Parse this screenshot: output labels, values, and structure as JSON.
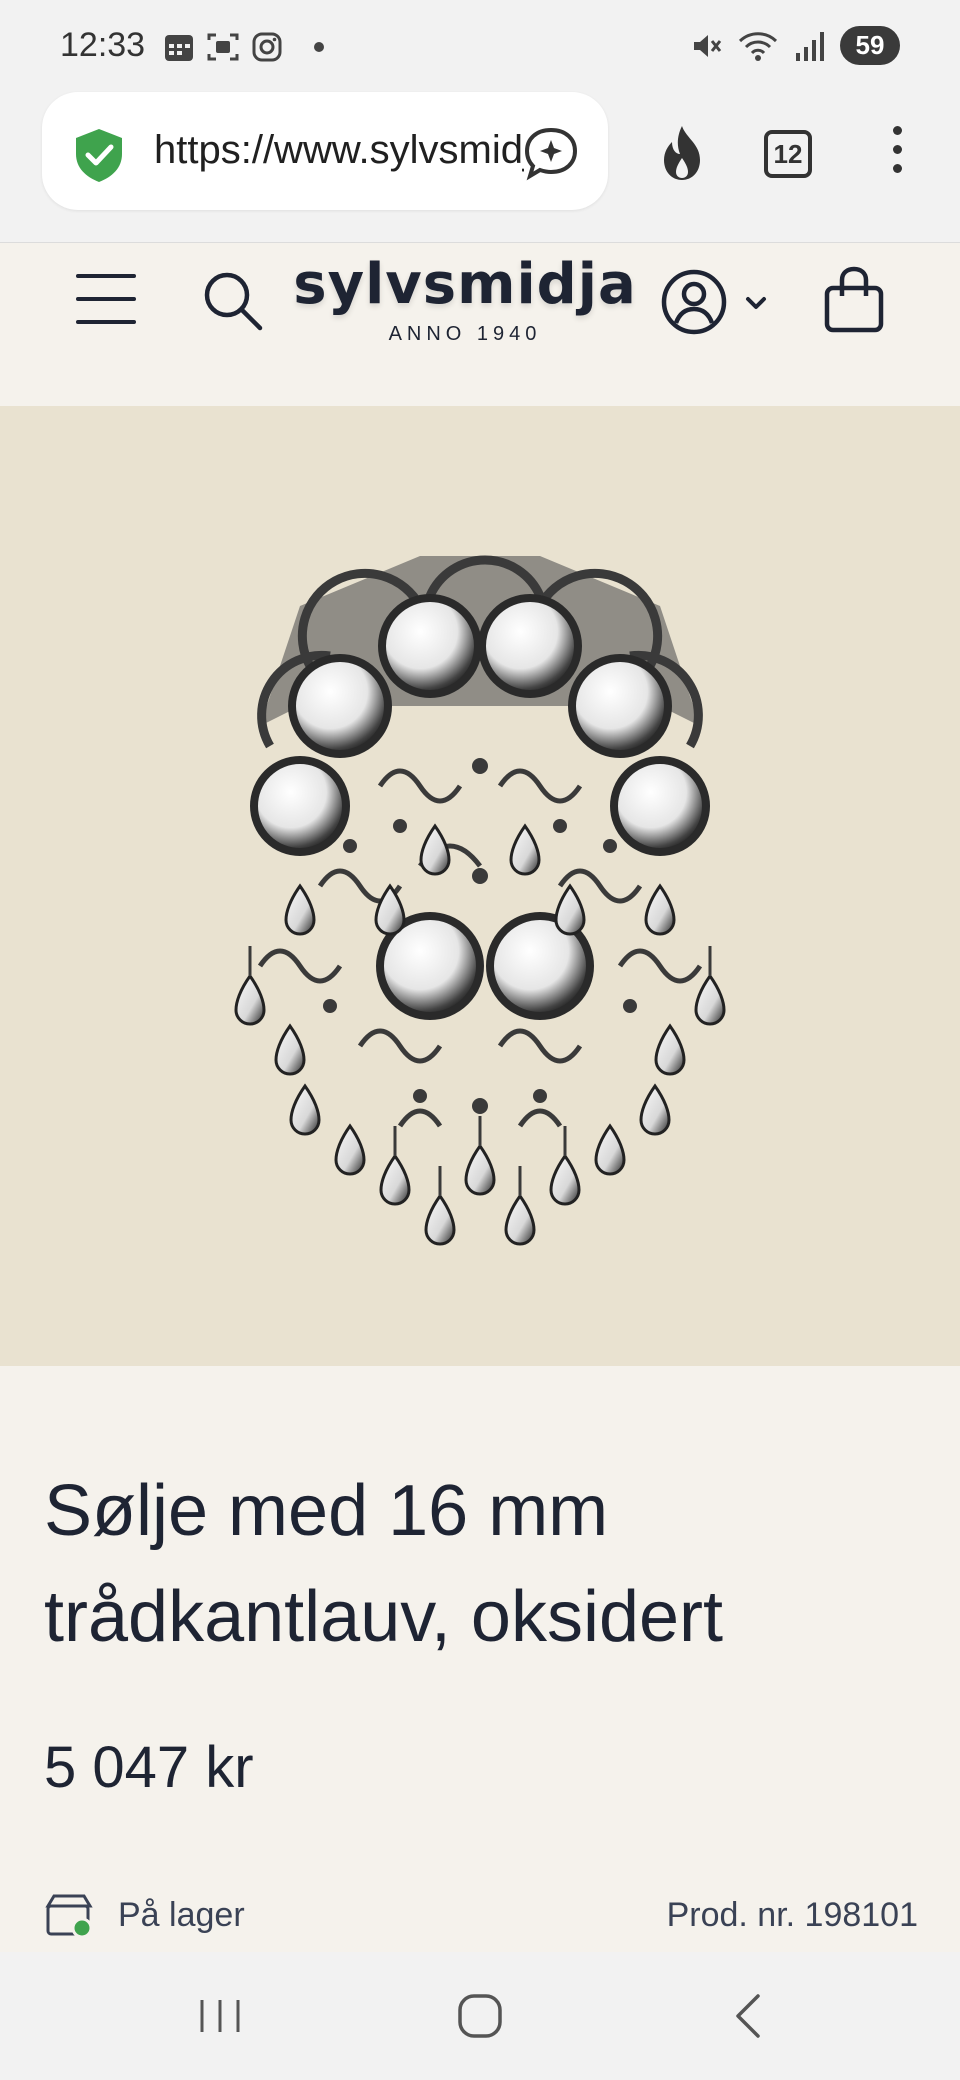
{
  "status_bar": {
    "time": "12:33",
    "battery": "59",
    "icons_left": [
      "calendar-icon",
      "screenshot-icon",
      "instagram-icon",
      "dot-icon"
    ],
    "icons_right": [
      "mute-icon",
      "wifi-icon",
      "signal-icon",
      "battery-icon"
    ]
  },
  "browser": {
    "url": "https://www.sylvsmidja.no",
    "tab_count": "12",
    "security_color": "#3fa34d"
  },
  "header": {
    "logo_main": "sylvsmidja",
    "logo_sub": "ANNO 1940"
  },
  "product": {
    "title_line1": "Sølje med 16 mm",
    "title_line2": "trådkantlauv, oksidert",
    "price": "5 047 kr",
    "stock": "På lager",
    "product_number": "Prod. nr. 198101",
    "image_bg": "#e9e2d0"
  },
  "colors": {
    "text": "#1e2433",
    "page_bg": "#f5f2ec",
    "stock_dot": "#3fa34d"
  }
}
